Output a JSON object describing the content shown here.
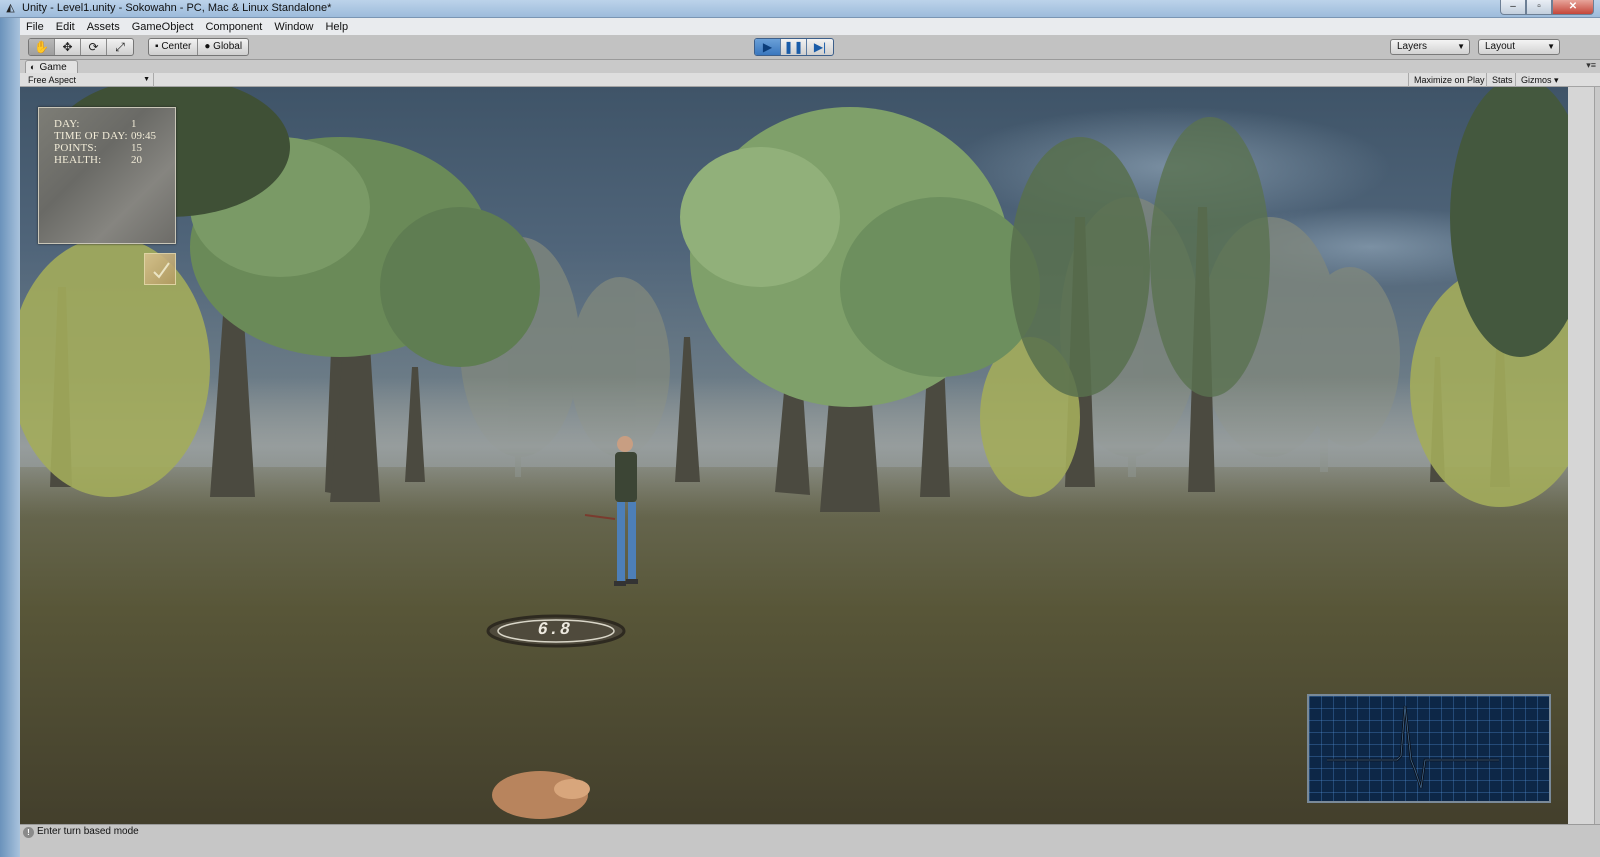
{
  "window": {
    "title": "Unity - Level1.unity - Sokowahn - PC, Mac & Linux Standalone*",
    "app_icon": "unity-logo-icon",
    "controls": [
      "minimize-icon",
      "maximize-icon",
      "close-icon"
    ]
  },
  "menu": [
    "File",
    "Edit",
    "Assets",
    "GameObject",
    "Component",
    "Window",
    "Help"
  ],
  "toolbar": {
    "tools": [
      "hand-icon",
      "move-icon",
      "rotate-icon",
      "scale-icon"
    ],
    "pivot_label": "Center",
    "space_label": "Global",
    "playback": [
      "play-icon",
      "pause-icon",
      "step-icon"
    ],
    "layers_label": "Layers",
    "layout_label": "Layout"
  },
  "game_panel": {
    "tab_label": "Game",
    "aspect": "Free Aspect",
    "maximize_label": "Maximize on Play",
    "stats_label": "Stats",
    "gizmos_label": "Gizmos"
  },
  "hud": {
    "labels": [
      "DAY:",
      "TIME OF DAY:",
      "POINTS:",
      "HEALTH:"
    ],
    "values": [
      "1",
      "09:45",
      "15",
      "20"
    ]
  },
  "ground_marker": {
    "distance": "6.8"
  },
  "status": {
    "message": "Enter turn based mode"
  },
  "colors": {
    "sky": "#3f5468",
    "fog": "#8a918f",
    "ground": "#4e4b36",
    "ecg_bg": "#0d2747",
    "play_active": "#3a77be"
  }
}
